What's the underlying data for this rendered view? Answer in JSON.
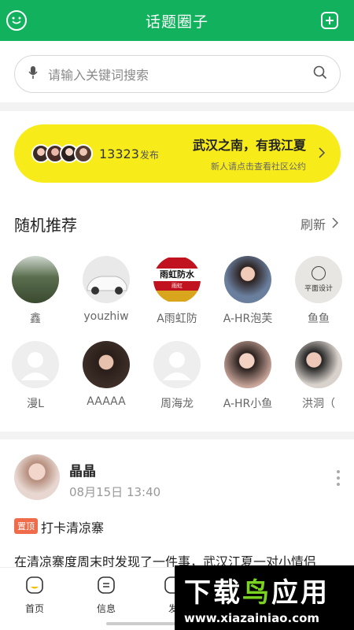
{
  "header": {
    "title": "话题圈子",
    "left_icon": "smiley-icon",
    "right_icon": "add-square-icon"
  },
  "search": {
    "placeholder": "请输入关键词搜索"
  },
  "banner": {
    "count": "13323",
    "count_suffix": "发布",
    "headline": "武汉之南，有我江夏",
    "subtext": "新人请点击查看社区公约"
  },
  "section": {
    "title": "随机推荐",
    "refresh": "刷新"
  },
  "users": [
    {
      "name": "鑫"
    },
    {
      "name": "youzhiw"
    },
    {
      "name": "A雨虹防"
    },
    {
      "name": "A-HR泡芙"
    },
    {
      "name": "鱼鱼"
    },
    {
      "name": "漫L"
    },
    {
      "name": "AAAAA"
    },
    {
      "name": "周海龙"
    },
    {
      "name": "A-HR小鱼"
    },
    {
      "name": "洪洞（"
    }
  ],
  "avatar_texts": {
    "waterproof_line1": "雨虹防水",
    "waterproof_line2": "雨虹",
    "design_line1": "平面设计"
  },
  "post": {
    "user": "晶晶",
    "time": "08月15日 13:40",
    "pin_label": "置顶",
    "title": "打卡清凉寨",
    "body": "在清凉寨度周末时发现了一件事，武汉江夏一对小情侣"
  },
  "nav": {
    "home": "首页",
    "messages": "信息",
    "post": "发"
  },
  "watermark": {
    "big_a": "下载",
    "big_b": "鸟",
    "big_c": "应用",
    "url": "www.xiazainiao.com"
  },
  "colors": {
    "brand_green": "#12b15e",
    "banner_yellow": "#f7ec1a",
    "pin_red": "#f06b4a"
  }
}
